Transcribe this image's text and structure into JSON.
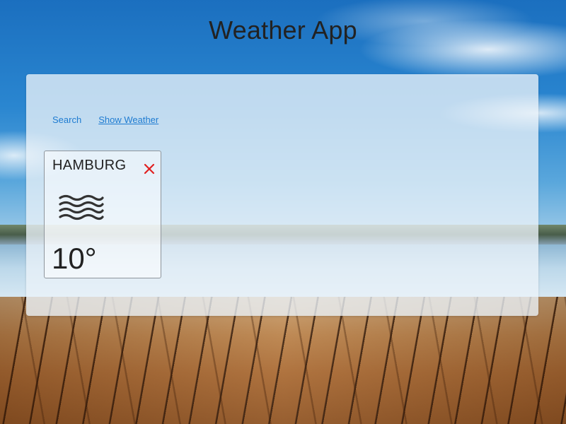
{
  "app": {
    "title": "Weather App"
  },
  "nav": {
    "search_label": "Search",
    "show_weather_label": "Show Weather"
  },
  "card": {
    "city": "HAMBURG",
    "temperature": "10°",
    "condition_icon": "fog-icon",
    "remove_icon": "close-icon"
  },
  "colors": {
    "link": "#1e7bd1",
    "close": "#e02020",
    "text": "#222222"
  }
}
